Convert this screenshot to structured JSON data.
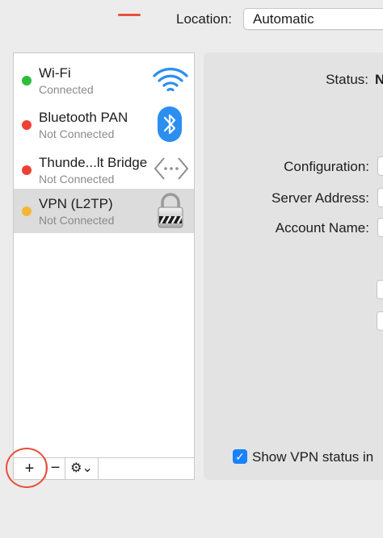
{
  "location": {
    "label": "Location:",
    "value": "Automatic"
  },
  "services": [
    {
      "name": "Wi-Fi",
      "status": "Connected",
      "dot_color": "#2ebd3a",
      "icon": "wifi-icon"
    },
    {
      "name": "Bluetooth PAN",
      "status": "Not Connected",
      "dot_color": "#ee4034",
      "icon": "bluetooth-icon"
    },
    {
      "name": "Thunde...lt Bridge",
      "status": "Not Connected",
      "dot_color": "#ee4034",
      "icon": "thunderbolt-bridge-icon"
    },
    {
      "name": "VPN (L2TP)",
      "status": "Not Connected",
      "dot_color": "#f5b731",
      "icon": "vpn-lock-icon",
      "selected": true
    }
  ],
  "toolbar": {
    "add": "+",
    "remove": "−",
    "action": "⚙⌄"
  },
  "detail": {
    "status_label": "Status:",
    "status_value": "N",
    "configuration_label": "Configuration:",
    "server_address_label": "Server Address:",
    "account_name_label": "Account Name:",
    "show_vpn_checkbox_mark": "✓",
    "show_vpn_label": "Show VPN status in"
  },
  "colors": {
    "accent": "#1a82fb",
    "annotation": "#e8503a"
  }
}
